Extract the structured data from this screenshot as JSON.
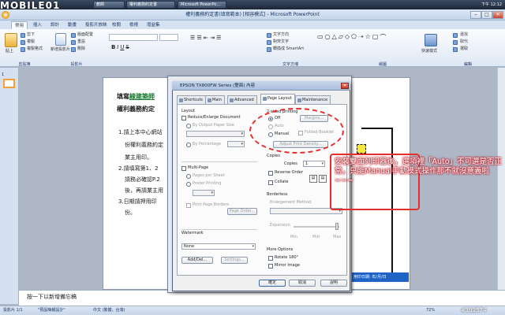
{
  "taskbar": {
    "logo": "MOBILE01",
    "tasks": [
      "教師",
      "權利義務約定書",
      "Microsoft PowerPo..."
    ],
    "clock": "下午 12:12"
  },
  "window": {
    "title": "權利義務約定書(填寫範本) [相容模式] - Microsoft PowerPoint"
  },
  "ribbon": {
    "tabs": [
      "常用",
      "插入",
      "設計",
      "動畫",
      "投影片放映",
      "校閱",
      "檢視",
      "增益集"
    ],
    "active_tab": "常用",
    "groups": [
      "剪貼簿",
      "投影片",
      "文字方塊",
      "繪圖",
      "編輯"
    ],
    "clipboard": {
      "paste": "貼上",
      "cut": "剪下",
      "copy": "複製",
      "format_painter": "複製格式"
    },
    "slides": {
      "new_slide": "新增投影片",
      "layout": "版面配置",
      "reset": "重設",
      "delete": "刪除"
    },
    "paragraph": {
      "text_direction": "文字方向",
      "align_text": "對齊文字",
      "smartart": "轉換成 SmartArt"
    },
    "editing": {
      "find": "尋找",
      "replace": "取代",
      "select": "選取"
    },
    "drawing": {
      "quick_styles": "快速樣式"
    }
  },
  "left_pane": {
    "slide_number": "1"
  },
  "slide": {
    "line1_prefix": "填寫",
    "line1_link": "線建築師",
    "line2": "權利義務約定",
    "items": [
      "1.請上本中心網站",
      "份權利義務約定",
      "業主用印。",
      "2.請填寫第1、2",
      "請務必確認P.2",
      "後，再請業主用",
      "3.日期請押用印",
      "份。"
    ],
    "bluebar": "用印日期: 年/月/日"
  },
  "notes": {
    "placeholder": "按一下以新增備忘稿"
  },
  "status": {
    "slide": "投影片 1/1",
    "theme": "\"預設簡報設計\"",
    "lang": "中文 (繁體，台灣)",
    "zoom": "72%",
    "watermark": "#192574"
  },
  "dialog": {
    "title": "EPSON TX800FW Series (雙面) 內容",
    "tabs": [
      "Shortcuts",
      "Main",
      "Advanced",
      "Page Layout",
      "Maintenance"
    ],
    "active_tab": "Page Layout",
    "layout": {
      "header": "Layout",
      "reduce": "Reduce/Enlarge Document",
      "output_size": "By Output Paper Size",
      "percentage": "By Percentage",
      "multi_page": "Multi-Page",
      "pages_per_sheet": "Pages per Sheet",
      "poster": "Poster Printing",
      "print_borders": "Print Page Borders",
      "page_order": "Page Order..."
    },
    "two_sided": {
      "header": "2-sided printing",
      "off": "Off",
      "auto": "Auto",
      "manual": "Manual",
      "margins": "Margins...",
      "folded": "Folded Booklet",
      "density": "Adjust Print Density...",
      "selected": "Off"
    },
    "copies": {
      "header": "Copies",
      "label": "Copies",
      "value": "1",
      "reverse": "Reverse Order",
      "collate": "Collate"
    },
    "borderless": {
      "header": "Borderless",
      "method": "Enlargement Method",
      "expansion": "Expansion",
      "min": "Min",
      "mid": "Mid",
      "max": "Max"
    },
    "watermark": {
      "header": "Watermark",
      "value": "None",
      "add": "Add/Del...",
      "settings": "Settings..."
    },
    "more": {
      "header": "More Options",
      "rotate": "Rotate 180°",
      "mirror": "Mirror Image"
    },
    "buttons": {
      "ok": "確定",
      "cancel": "取消",
      "help": "說明"
    }
  },
  "annotation": {
    "text": "安裝雙面列印器後，選項裡「Auto」不可選是否正常，只能Manual手動模式操作那不就沒意義啦~~~"
  },
  "colors": {
    "accent": "#e62d2d",
    "link": "#1a7a2f",
    "ribbon": "#dfe8f5"
  }
}
